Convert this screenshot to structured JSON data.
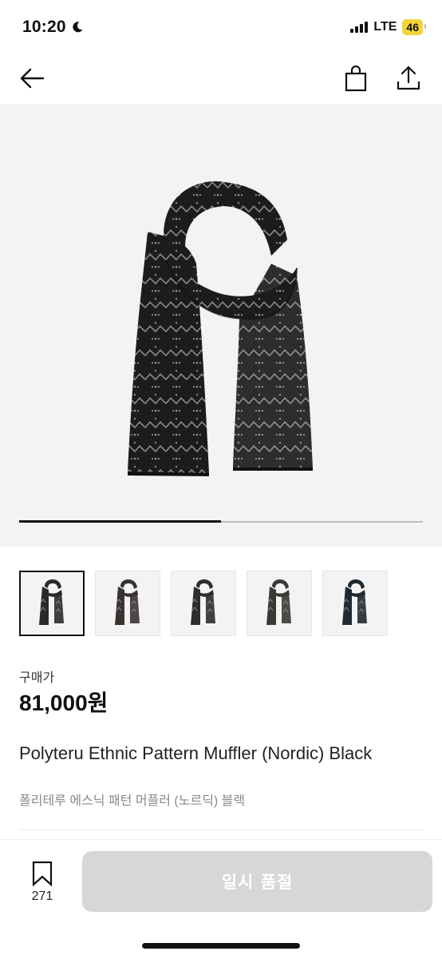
{
  "status_bar": {
    "time": "10:20",
    "network": "LTE",
    "battery": "46",
    "icons": [
      "moon-icon",
      "signal-icon"
    ]
  },
  "nav": {
    "icons": [
      "back-arrow-icon",
      "shopping-bag-icon",
      "share-icon"
    ]
  },
  "gallery": {
    "current_image": 1,
    "image_count": 2,
    "thumbnail_count": 5,
    "selected_thumbnail": 1,
    "thumbnail_colors": [
      "#2a2a2a",
      "#3a3230",
      "#2c2d2f",
      "#3a3a34",
      "#1f2a30"
    ]
  },
  "product": {
    "price_label": "구매가",
    "price": "81,000원",
    "name_en": "Polyteru Ethnic Pattern Muffler (Nordic) Black",
    "name_ko": "폴리테루 에스닉 패턴 머플러 (노르딕) 블랙"
  },
  "bottom_bar": {
    "wish_count": "271",
    "sold_out_label": "일시 품절"
  },
  "colors": {
    "accent_disabled": "#d7d7d7",
    "battery": "#f2d43a",
    "scarf": "#1c1c1c",
    "pattern": "#8a8a8a"
  }
}
